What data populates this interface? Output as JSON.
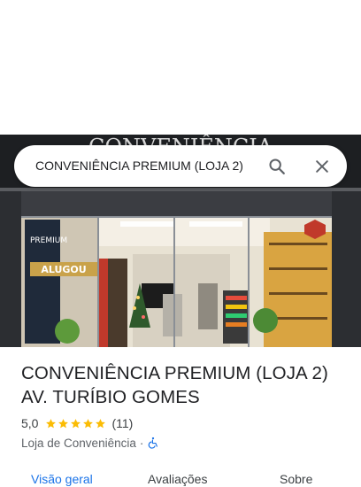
{
  "search": {
    "query": "CONVENIÊNCIA PREMIUM (LOJA 2)"
  },
  "icons": {
    "search": "search-icon",
    "close": "close-icon",
    "star": "star-icon",
    "accessibility": "wheelchair-icon"
  },
  "colors": {
    "accent": "#1a73e8",
    "star": "#fbbc04",
    "text": "#202124",
    "secondary": "#5f6368"
  },
  "place": {
    "name_line1": "CONVENIÊNCIA PREMIUM (LOJA 2)",
    "name_line2": "AV. TURÍBIO GOMES",
    "rating": "5,0",
    "stars": 5,
    "reviews": "(11)",
    "category": "Loja de Conveniência",
    "separator": "·"
  },
  "photo": {
    "sign_text": "CONVENIÊNCIA",
    "banner_text": "PREMIUM",
    "alugou_text": "ALUGOU"
  },
  "tabs": [
    {
      "label": "Visão geral"
    },
    {
      "label": "Avaliações"
    },
    {
      "label": "Sobre"
    }
  ]
}
